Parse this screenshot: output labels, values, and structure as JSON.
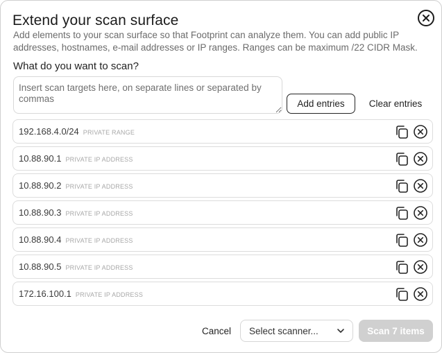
{
  "dialog": {
    "title": "Extend your scan surface",
    "description": "Add elements to your scan surface so that Footprint can analyze them. You can add public IP addresses, hostnames, e-mail addresses or IP ranges. Ranges can be maximum /22 CIDR Mask.",
    "question": "What do you want to scan?",
    "close_icon": "close-circle-icon"
  },
  "input": {
    "placeholder": "Insert scan targets here, on separate lines or separated by commas",
    "value": ""
  },
  "actions": {
    "add_label": "Add entries",
    "clear_label": "Clear entries"
  },
  "entries": [
    {
      "value": "192.168.4.0/24",
      "type": "PRIVATE RANGE"
    },
    {
      "value": "10.88.90.1",
      "type": "PRIVATE IP ADDRESS"
    },
    {
      "value": "10.88.90.2",
      "type": "PRIVATE IP ADDRESS"
    },
    {
      "value": "10.88.90.3",
      "type": "PRIVATE IP ADDRESS"
    },
    {
      "value": "10.88.90.4",
      "type": "PRIVATE IP ADDRESS"
    },
    {
      "value": "10.88.90.5",
      "type": "PRIVATE IP ADDRESS"
    },
    {
      "value": "172.16.100.1",
      "type": "PRIVATE IP ADDRESS"
    }
  ],
  "footer": {
    "cancel_label": "Cancel",
    "scanner_selected": "Select scanner...",
    "scan_label": "Scan 7 items"
  },
  "colors": {
    "disabled_button": "#d0d0d0",
    "border": "#dcdcdc",
    "text": "#222222"
  }
}
